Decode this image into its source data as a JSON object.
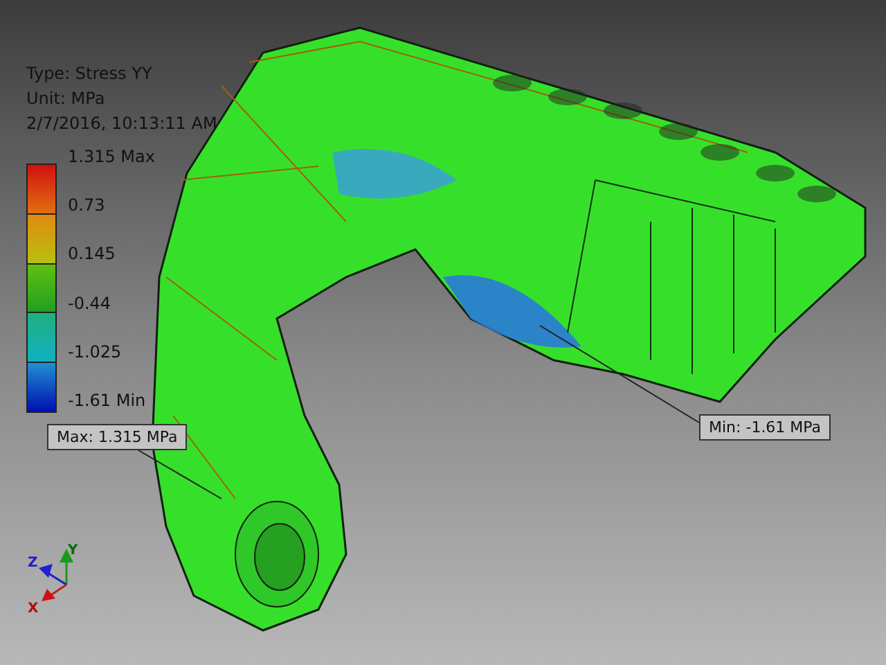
{
  "info": {
    "type": "Type: Stress YY",
    "unit": "Unit: MPa",
    "timestamp": "2/7/2016, 10:13:11 AM"
  },
  "legend": {
    "max_label": "1.315 Max",
    "labels": [
      "0.73",
      "0.145",
      "-0.44",
      "-1.025"
    ],
    "min_label": "-1.61 Min"
  },
  "callouts": [
    {
      "kind": "max",
      "text": "Max: 1.315 MPa"
    },
    {
      "kind": "min",
      "text": "Min: -1.61 MPa"
    }
  ],
  "triad": {
    "x": "X",
    "y": "Y",
    "z": "Z"
  }
}
